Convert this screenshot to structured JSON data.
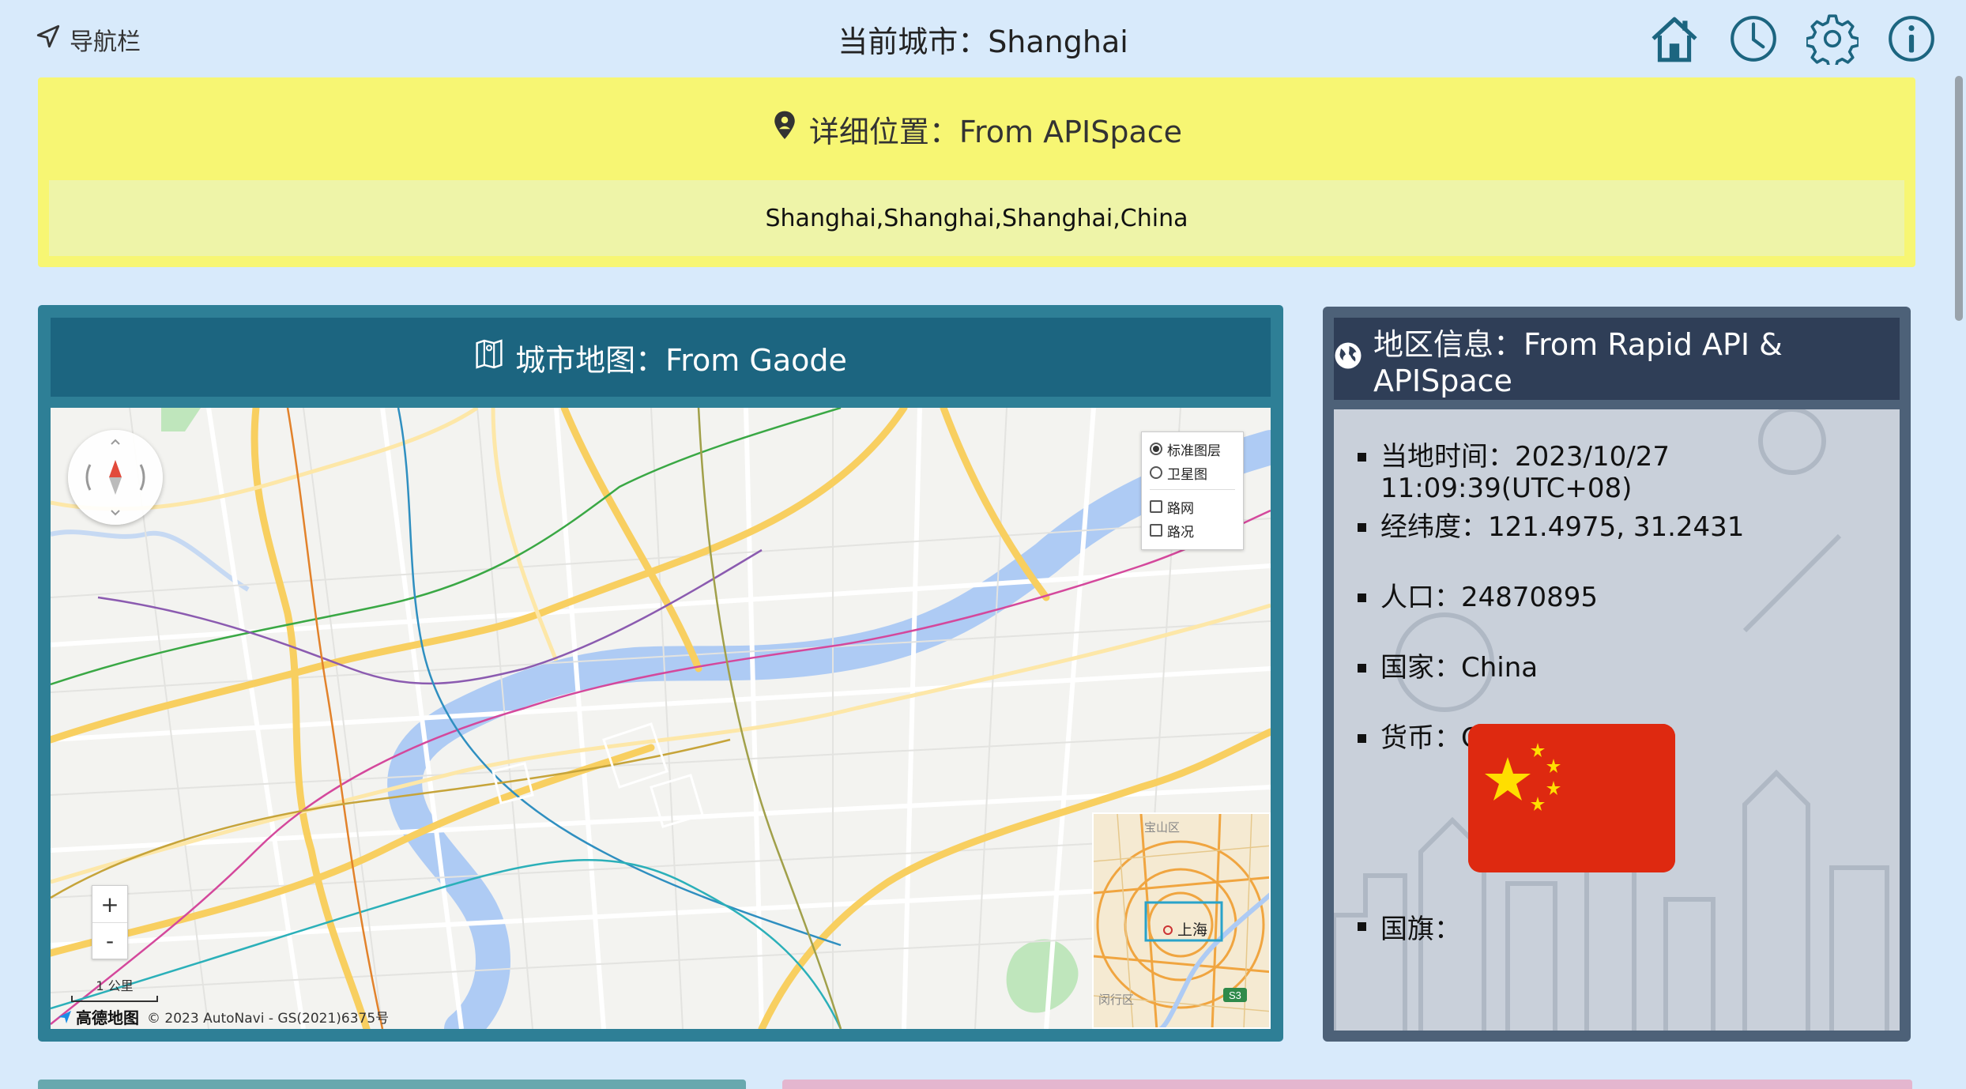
{
  "nav": {
    "label": "导航栏"
  },
  "header": {
    "title": "当前城市：Shanghai"
  },
  "location": {
    "title": "详细位置：From APISpace",
    "value": "Shanghai,Shanghai,Shanghai,China"
  },
  "map": {
    "title": "城市地图：From Gaode",
    "layers": {
      "standard": "标准图层",
      "satellite": "卫星图",
      "roadnet": "路网",
      "traffic": "路况"
    },
    "zoom_in": "+",
    "zoom_out": "-",
    "scale_label": "1 公里",
    "logo_text": "高德地图",
    "copyright": "© 2023 AutoNavi - GS(2021)6375号",
    "minimap_labels": {
      "north": "宝山区",
      "center": "上海",
      "south": "闵行区",
      "road": "S3"
    }
  },
  "region": {
    "title": "地区信息：From Rapid API & APISpace",
    "items": [
      "当地时间：2023/10/27 11:09:39(UTC+08)",
      "经纬度：121.4975, 31.2431",
      "人口：24870895",
      "国家：China",
      "货币：CNY(CN¥)"
    ],
    "flag_label": "国旗："
  },
  "colors": {
    "page_bg": "#d8eafb",
    "location_card": "#f7f673",
    "map_card": "#2e7f96",
    "info_card": "#4d6178",
    "flag_red": "#de2910",
    "flag_yellow": "#ffde00"
  },
  "icons": [
    "navigation-arrow-icon",
    "home-icon",
    "clock-icon",
    "gear-icon",
    "info-icon",
    "location-pin-icon",
    "map-icon",
    "globe-icon"
  ]
}
